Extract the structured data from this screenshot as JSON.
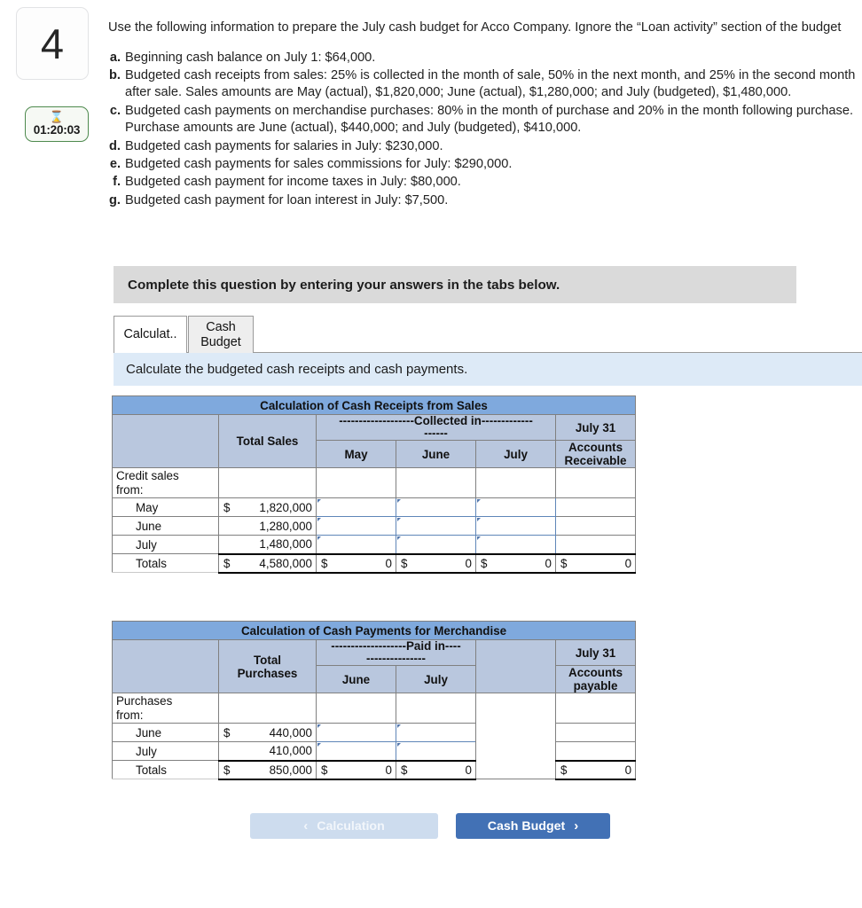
{
  "question": {
    "number": "4",
    "timer": {
      "icon": "hourglass-icon",
      "glyph": "⌛",
      "value": "01:20:03"
    },
    "intro": "Use the following information to prepare the July cash budget for Acco Company. Ignore the “Loan activity” section of the budget",
    "items": [
      {
        "label": "a.",
        "text": "Beginning cash balance on July 1: $64,000."
      },
      {
        "label": "b.",
        "text": "Budgeted cash receipts from sales: 25% is collected in the month of sale, 50% in the next month, and 25% in the second month after sale. Sales amounts are May (actual), $1,820,000; June (actual), $1,280,000; and July (budgeted), $1,480,000."
      },
      {
        "label": "c.",
        "text": "Budgeted cash payments on merchandise purchases: 80% in the month of purchase and 20% in the month following purchase. Purchase amounts are June (actual), $440,000; and July (budgeted), $410,000."
      },
      {
        "label": "d.",
        "text": "Budgeted cash payments for salaries in July: $230,000."
      },
      {
        "label": "e.",
        "text": "Budgeted cash payments for sales commissions for July: $290,000."
      },
      {
        "label": "f.",
        "text": "Budgeted cash payment for income taxes in July: $80,000."
      },
      {
        "label": "g.",
        "text": "Budgeted cash payment for loan interest in July: $7,500."
      }
    ]
  },
  "banner": {
    "text": "Complete this question by entering your answers in the tabs below."
  },
  "tabs": [
    {
      "label": "Calculat..",
      "active": true
    },
    {
      "label": "Cash Budget",
      "line1": "Cash",
      "line2": "Budget",
      "active": false
    }
  ],
  "sub_instruction": {
    "text": "Calculate the budgeted cash receipts and cash payments."
  },
  "table_receipts": {
    "title": "Calculation of Cash Receipts from Sales",
    "col_total": "Total Sales",
    "group_header": "-------------------Collected in-------------",
    "group_header_line2": "------",
    "months": [
      "May",
      "June",
      "July"
    ],
    "right_header_line1": "July 31",
    "right_header_line2": "Accounts",
    "right_header_line3": "Receivable",
    "section_label_line1": "Credit sales",
    "section_label_line2": "from:",
    "rows": [
      {
        "label": "May",
        "total_sym": "$",
        "total": "1,820,000",
        "inputs": [
          "",
          "",
          ""
        ],
        "ar": ""
      },
      {
        "label": "June",
        "total_sym": "",
        "total": "1,280,000",
        "inputs": [
          "",
          "",
          ""
        ],
        "ar": ""
      },
      {
        "label": "July",
        "total_sym": "",
        "total": "1,480,000",
        "inputs": [
          "",
          "",
          ""
        ],
        "ar": ""
      }
    ],
    "totals": {
      "label": "Totals",
      "total_sym": "$",
      "total": "4,580,000",
      "may_sym": "$",
      "may": "0",
      "june_sym": "$",
      "june": "0",
      "july_sym": "$",
      "july": "0",
      "ar_sym": "$",
      "ar": "0"
    }
  },
  "table_payments": {
    "title": "Calculation of Cash Payments for Merchandise",
    "col_total_line1": "Total",
    "col_total_line2": "Purchases",
    "group_header": "-------------------Paid in----",
    "group_header_line2": "---------------",
    "months": [
      "June",
      "July"
    ],
    "right_header_line1": "July 31",
    "right_header_line2": "Accounts",
    "right_header_line3": "payable",
    "section_label_line1": "Purchases",
    "section_label_line2": "from:",
    "rows": [
      {
        "label": "June",
        "total_sym": "$",
        "total": "440,000",
        "inputs": [
          "",
          ""
        ],
        "ap": ""
      },
      {
        "label": "July",
        "total_sym": "",
        "total": "410,000",
        "inputs": [
          "",
          ""
        ],
        "ap": ""
      }
    ],
    "totals": {
      "label": "Totals",
      "total_sym": "$",
      "total": "850,000",
      "june_sym": "$",
      "june": "0",
      "july_sym": "$",
      "july": "0",
      "ap_sym": "$",
      "ap": "0"
    }
  },
  "nav": {
    "prev_label": "Calculation",
    "prev_chevron": "‹",
    "next_label": "Cash Budget",
    "next_chevron": "›"
  },
  "colors": {
    "title_blue": "#7fa9dd",
    "header_blue_grey": "#b9c7de",
    "banner_grey": "#dadada",
    "sub_instruction_blue": "#ddeaf7",
    "next_button_blue": "#4271b5",
    "prev_button_blue": "#cddcee",
    "timer_green": "#4e8a4e"
  }
}
